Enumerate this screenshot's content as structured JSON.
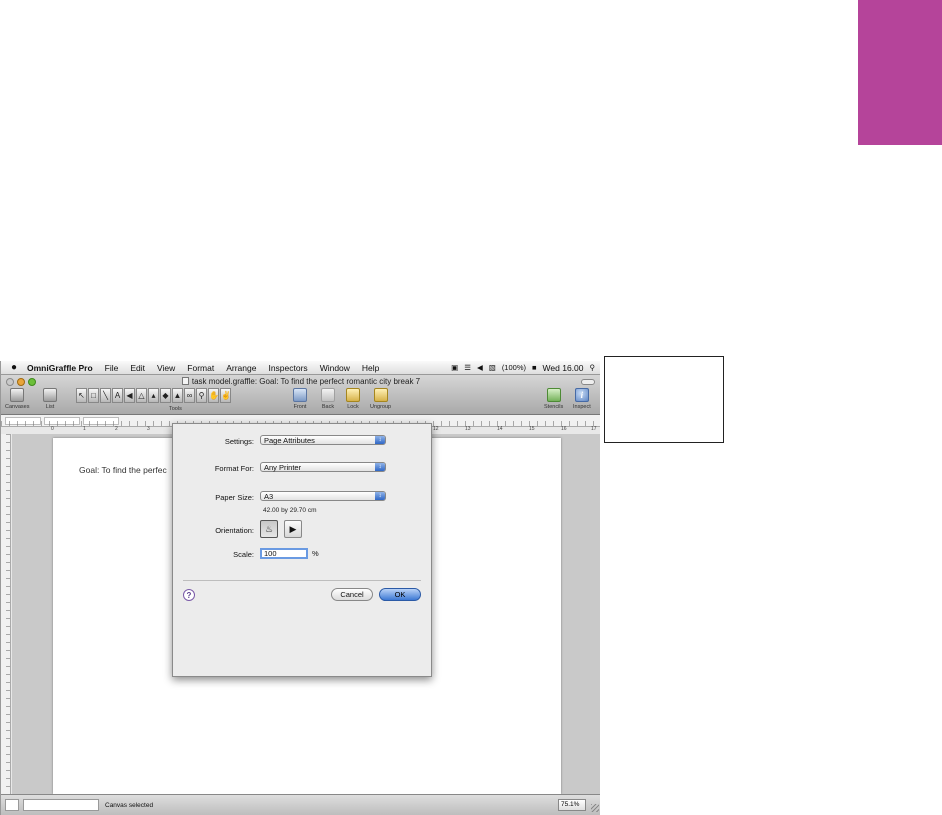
{
  "accent": "#b5449a",
  "menubar": {
    "apple_icon": "apple-icon",
    "menus": [
      "OmniGraffle Pro",
      "File",
      "Edit",
      "View",
      "Format",
      "Arrange",
      "Inspectors",
      "Window",
      "Help"
    ],
    "battery": "(100%)",
    "clock": "Wed 16.00"
  },
  "window": {
    "title": "task model.graffle: Goal: To find the perfect romantic city break 7"
  },
  "toolbar": {
    "canvases_label": "Canvases",
    "list_label": "List",
    "tools_label": "Tools",
    "front_label": "Front",
    "back_label": "Back",
    "lock_label": "Lock",
    "ungroup_label": "Ungroup",
    "stencils_label": "Stencils",
    "inspect_label": "Inspect"
  },
  "ruler": {
    "numbers": [
      "0",
      "1",
      "2",
      "3",
      "12",
      "13",
      "14",
      "15",
      "16",
      "17"
    ]
  },
  "canvas": {
    "text": "Goal: To find the perfec"
  },
  "dialog": {
    "settings_label": "Settings:",
    "settings_value": "Page Attributes",
    "format_for_label": "Format For:",
    "format_for_value": "Any Printer",
    "paper_size_label": "Paper Size:",
    "paper_size_value": "A3",
    "paper_dimensions": "42.00 by 29.70 cm",
    "orientation_label": "Orientation:",
    "scale_label": "Scale:",
    "scale_value": "100",
    "percent": "%",
    "help": "?",
    "cancel": "Cancel",
    "ok": "OK"
  },
  "statusbar": {
    "status_text": "Canvas selected",
    "zoom": "75.1%"
  }
}
